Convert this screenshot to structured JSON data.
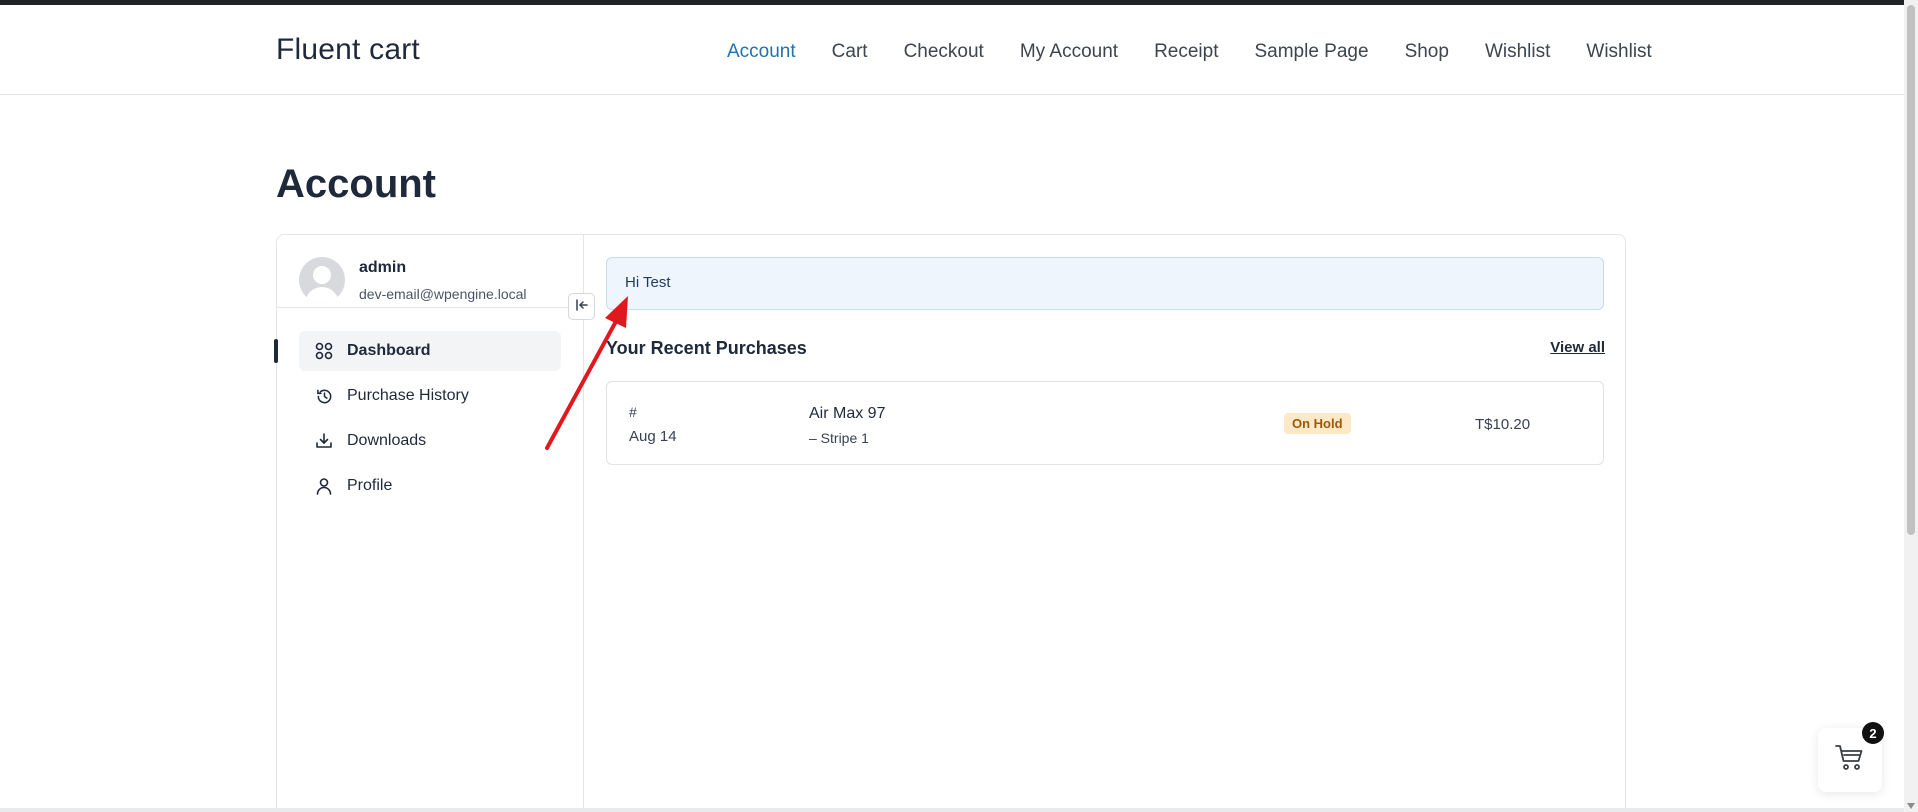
{
  "site": {
    "title": "Fluent cart"
  },
  "nav": {
    "items": [
      {
        "label": "Account",
        "active": true
      },
      {
        "label": "Cart"
      },
      {
        "label": "Checkout"
      },
      {
        "label": "My Account"
      },
      {
        "label": "Receipt"
      },
      {
        "label": "Sample Page"
      },
      {
        "label": "Shop"
      },
      {
        "label": "Wishlist"
      },
      {
        "label": "Wishlist"
      }
    ]
  },
  "page": {
    "title": "Account"
  },
  "user": {
    "name": "admin",
    "email": "dev-email@wpengine.local"
  },
  "sidebar": {
    "items": [
      {
        "label": "Dashboard",
        "icon": "grid-icon",
        "active": true
      },
      {
        "label": "Purchase History",
        "icon": "history-icon"
      },
      {
        "label": "Downloads",
        "icon": "download-icon"
      },
      {
        "label": "Profile",
        "icon": "user-icon"
      }
    ]
  },
  "main": {
    "greeting": "Hi Test",
    "recent_title": "Your Recent Purchases",
    "view_all": "View all",
    "orders": [
      {
        "number": "#",
        "date": "Aug 14",
        "product": "Air Max 97",
        "variant": "– Stripe 1",
        "status": "On Hold",
        "total": "T$10.20"
      }
    ]
  },
  "cart": {
    "count": "2"
  },
  "colors": {
    "accent": "#2271b1",
    "annotation": "#e0191f",
    "badge_bg": "#fde9c8",
    "badge_text": "#9a5a06",
    "greeting_bg": "#eef5fd"
  }
}
